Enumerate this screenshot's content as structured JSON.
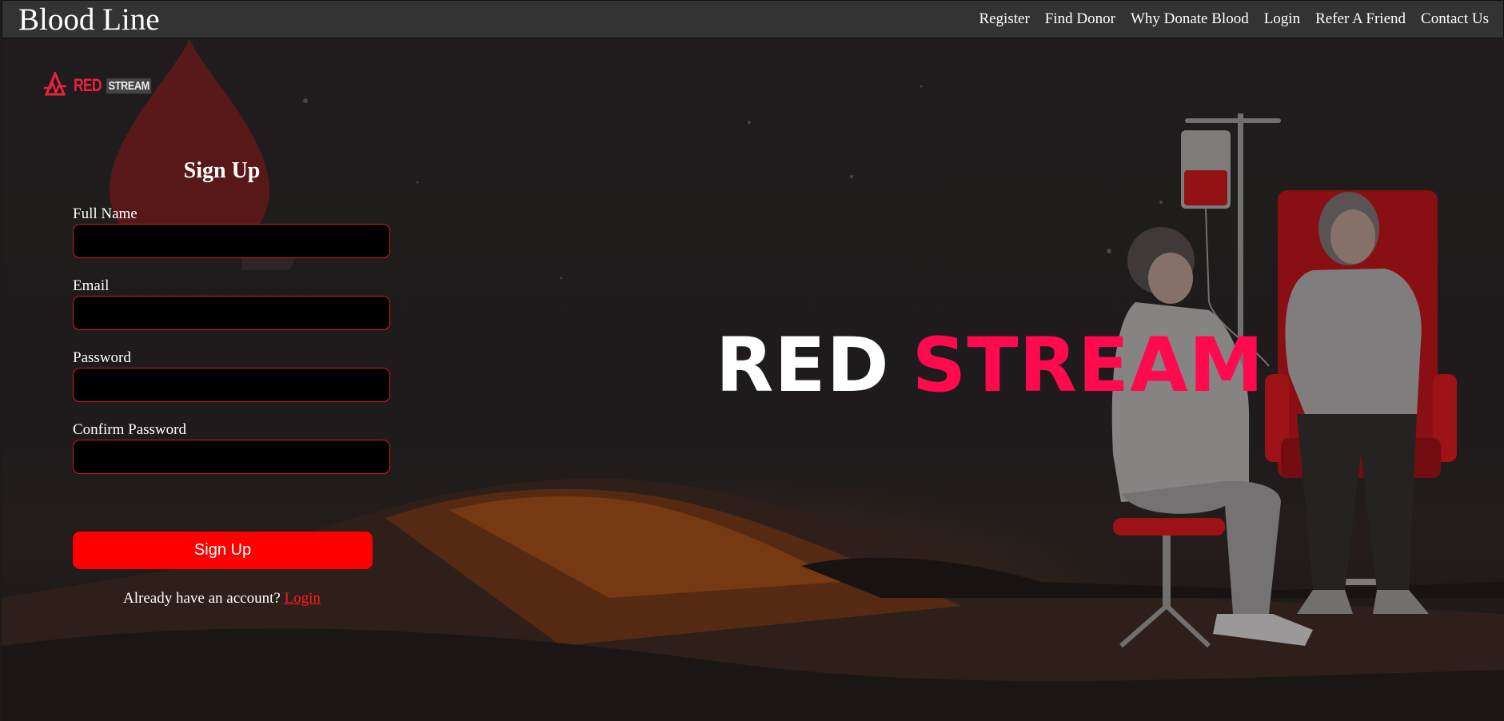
{
  "navbar": {
    "brand": "Blood Line",
    "links": [
      "Register",
      "Find Donor",
      "Why Donate Blood",
      "Login",
      "Refer A Friend",
      "Contact Us"
    ]
  },
  "logo": {
    "red": "RED",
    "stream": "STREAM"
  },
  "form": {
    "title": "Sign Up",
    "fields": [
      {
        "label": "Full Name",
        "value": ""
      },
      {
        "label": "Email",
        "value": ""
      },
      {
        "label": "Password",
        "value": ""
      },
      {
        "label": "Confirm Password",
        "value": ""
      }
    ],
    "submit_label": "Sign Up",
    "login_prompt": "Already have an account?",
    "login_link": "Login"
  },
  "hero": {
    "title_part1": "RED",
    "title_part2": "STREAM"
  },
  "colors": {
    "navbar_bg": "#333333",
    "accent_red": "#ff0000",
    "title_pink": "#ff0a4f",
    "input_border": "#d11a1a"
  },
  "icons": [
    "blood-drop-icon",
    "heartbeat-logo-icon"
  ]
}
